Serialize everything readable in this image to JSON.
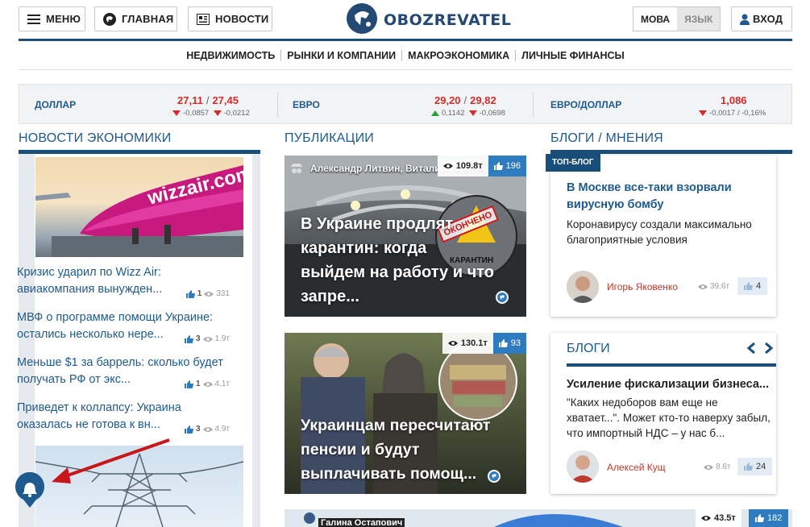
{
  "header": {
    "menu_label": "МЕНЮ",
    "home_label": "ГЛАВНАЯ",
    "news_label": "НОВОСТИ",
    "logo_text": "OBOZREVATEL",
    "lang_active": "МОВА",
    "lang_inactive": "ЯЗЫК",
    "login_label": "ВХОД"
  },
  "subnav": [
    "НЕДВИЖИМОСТЬ",
    "РЫНКИ И КОМПАНИИ",
    "МАКРОЭКОНОМИКА",
    "ЛИЧНЫЕ ФИНАНСЫ"
  ],
  "currency": [
    {
      "name": "ДОЛЛАР",
      "buy": "27,11",
      "sell": "27,45",
      "buy_chg": "-0,0857",
      "sell_chg": "-0,0212"
    },
    {
      "name": "ЕВРО",
      "buy": "29,20",
      "sell": "29,82",
      "buy_chg": "0,1142",
      "sell_chg": "-0,0698"
    },
    {
      "name": "ЕВРО/ДОЛЛАР",
      "value": "1,086",
      "chg": "-0,0017 / -0,16%"
    }
  ],
  "sections": {
    "economy": "НОВОСТИ ЭКОНОМИКИ",
    "publications": "ПУБЛИКАЦИИ",
    "blogs_opinions": "БЛОГИ / МНЕНИЯ"
  },
  "economy_news": [
    {
      "title": "Кризис ударил по Wizz Air: авиакомпания вынужден...",
      "likes": "1",
      "views": "331"
    },
    {
      "title": "МВФ о программе помощи Украине: остались несколько нере...",
      "likes": "3",
      "views": "1.9т"
    },
    {
      "title": "Меньше $1 за баррель: сколько будет получать РФ от экс...",
      "likes": "1",
      "views": "4.1т"
    },
    {
      "title": "Приведет к коллапсу: Украина оказалась не готова к вн...",
      "likes": "3",
      "views": "4.9т"
    }
  ],
  "plane_brand": "wizzair.com",
  "publications": [
    {
      "authors": "Александр Литвин, Виталий Тысячный",
      "views": "109.8т",
      "likes": "196",
      "title": "В Украине продлят карантин: когда выйдем на работу и что запре...",
      "stamp_top": "ОКОНЧЕНО",
      "stamp_bottom": "КАРАНТИН"
    },
    {
      "views": "130.1т",
      "likes": "93",
      "title": "Украинцам пересчитают пенсии и будут выплачивать помощ..."
    }
  ],
  "bottom_strip": {
    "author": "Галина Остапович",
    "views": "43.5т",
    "likes": "182"
  },
  "top_blog": {
    "badge": "ТОП-БЛОГ",
    "title": "В Москве все-таки взорвали вирусную бомбу",
    "text": "Коронавирусу создали максимально благоприятные условия",
    "author": "Игорь Яковенко",
    "views": "39.6т",
    "likes": "4"
  },
  "blogs": {
    "header": "БЛОГИ",
    "title": "Усиление фискализации бизнеса...",
    "text": "\"Каких недоборов вам еще не хватает...\". Может кто-то наверху забыл, что импортный НДС – у нас б...",
    "author": "Алексей Кущ",
    "views": "8.6т",
    "likes": "24"
  },
  "colors": {
    "brand": "#1a4e7a",
    "link": "#1e5a8e",
    "down": "#d62b2b",
    "up": "#2aa03a"
  }
}
